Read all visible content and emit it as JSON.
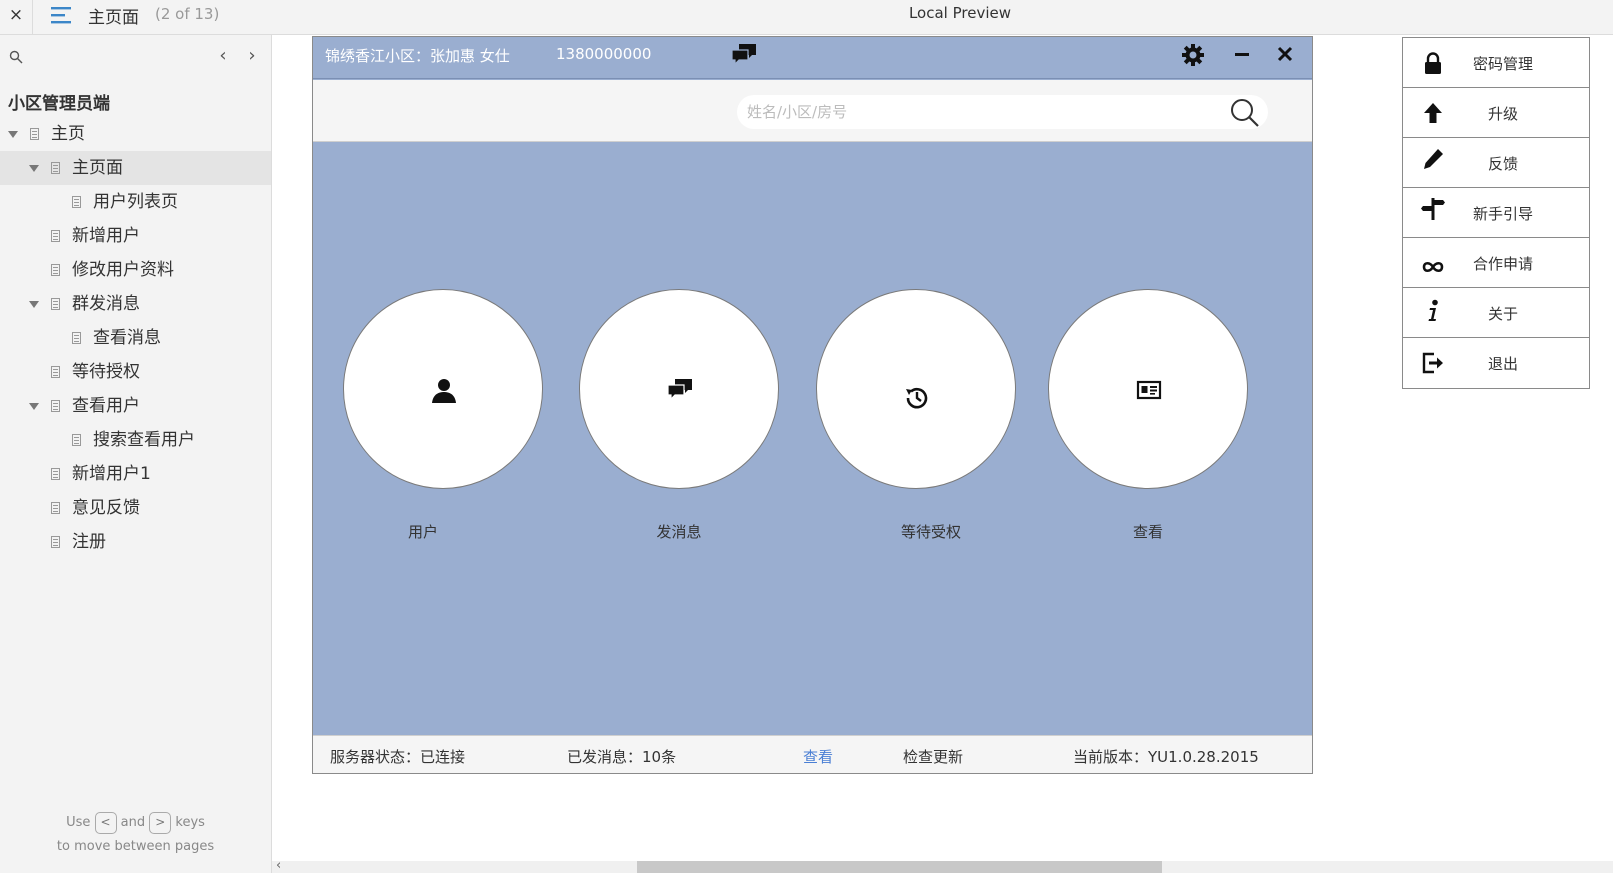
{
  "topbar": {
    "close_glyph": "×",
    "page_name": "主页面",
    "page_count": "(2 of 13)",
    "preview_title": "Local Preview"
  },
  "sidebar": {
    "project_title": "小区管理员端",
    "tree": [
      {
        "label": "主页",
        "level": 0,
        "expanded": true,
        "selected": false
      },
      {
        "label": "主页面",
        "level": 1,
        "expanded": true,
        "selected": true
      },
      {
        "label": "用户列表页",
        "level": 2,
        "expanded": false,
        "selected": false
      },
      {
        "label": "新增用户",
        "level": 1,
        "expanded": false,
        "selected": false
      },
      {
        "label": "修改用户资料",
        "level": 1,
        "expanded": false,
        "selected": false
      },
      {
        "label": "群发消息",
        "level": 1,
        "expanded": true,
        "selected": false
      },
      {
        "label": "查看消息",
        "level": 2,
        "expanded": false,
        "selected": false
      },
      {
        "label": "等待授权",
        "level": 1,
        "expanded": false,
        "selected": false
      },
      {
        "label": "查看用户",
        "level": 1,
        "expanded": true,
        "selected": false
      },
      {
        "label": "搜索查看用户",
        "level": 2,
        "expanded": false,
        "selected": false
      },
      {
        "label": "新增用户1",
        "level": 1,
        "expanded": false,
        "selected": false
      },
      {
        "label": "意见反馈",
        "level": 1,
        "expanded": false,
        "selected": false
      },
      {
        "label": "注册",
        "level": 1,
        "expanded": false,
        "selected": false
      }
    ],
    "hint": {
      "use": "Use",
      "key_prev": "<",
      "and": "and",
      "key_next": ">",
      "keys": "keys",
      "line2": "to move between pages"
    }
  },
  "app": {
    "header": {
      "community": "锦绣香江小区：张加惠   女仕",
      "phone": "1380000000"
    },
    "search": {
      "placeholder": "姓名/小区/房号",
      "value": ""
    },
    "tiles": [
      {
        "label": "用户",
        "icon": "user-icon"
      },
      {
        "label": "发消息",
        "icon": "chat-icon"
      },
      {
        "label": "等待受权",
        "icon": "history-icon"
      },
      {
        "label": "查看",
        "icon": "id-card-icon"
      }
    ],
    "status": {
      "server": "服务器状态：已连接",
      "sent": "已发消息：10条",
      "view_link": "查看",
      "check_update": "检查更新",
      "version": "当前版本：YU1.0.28.2015"
    },
    "colors": {
      "background": "#9aaed0",
      "link": "#4a7fd4"
    }
  },
  "menu": {
    "items": [
      {
        "label": "密码管理",
        "icon": "lock-icon"
      },
      {
        "label": "升级",
        "icon": "arrow-up-icon"
      },
      {
        "label": "反馈",
        "icon": "pencil-icon"
      },
      {
        "label": "新手引导",
        "icon": "signpost-icon"
      },
      {
        "label": "合作申请",
        "icon": "infinity-icon"
      },
      {
        "label": "关于",
        "icon": "info-icon"
      },
      {
        "label": "退出",
        "icon": "logout-icon"
      }
    ]
  }
}
